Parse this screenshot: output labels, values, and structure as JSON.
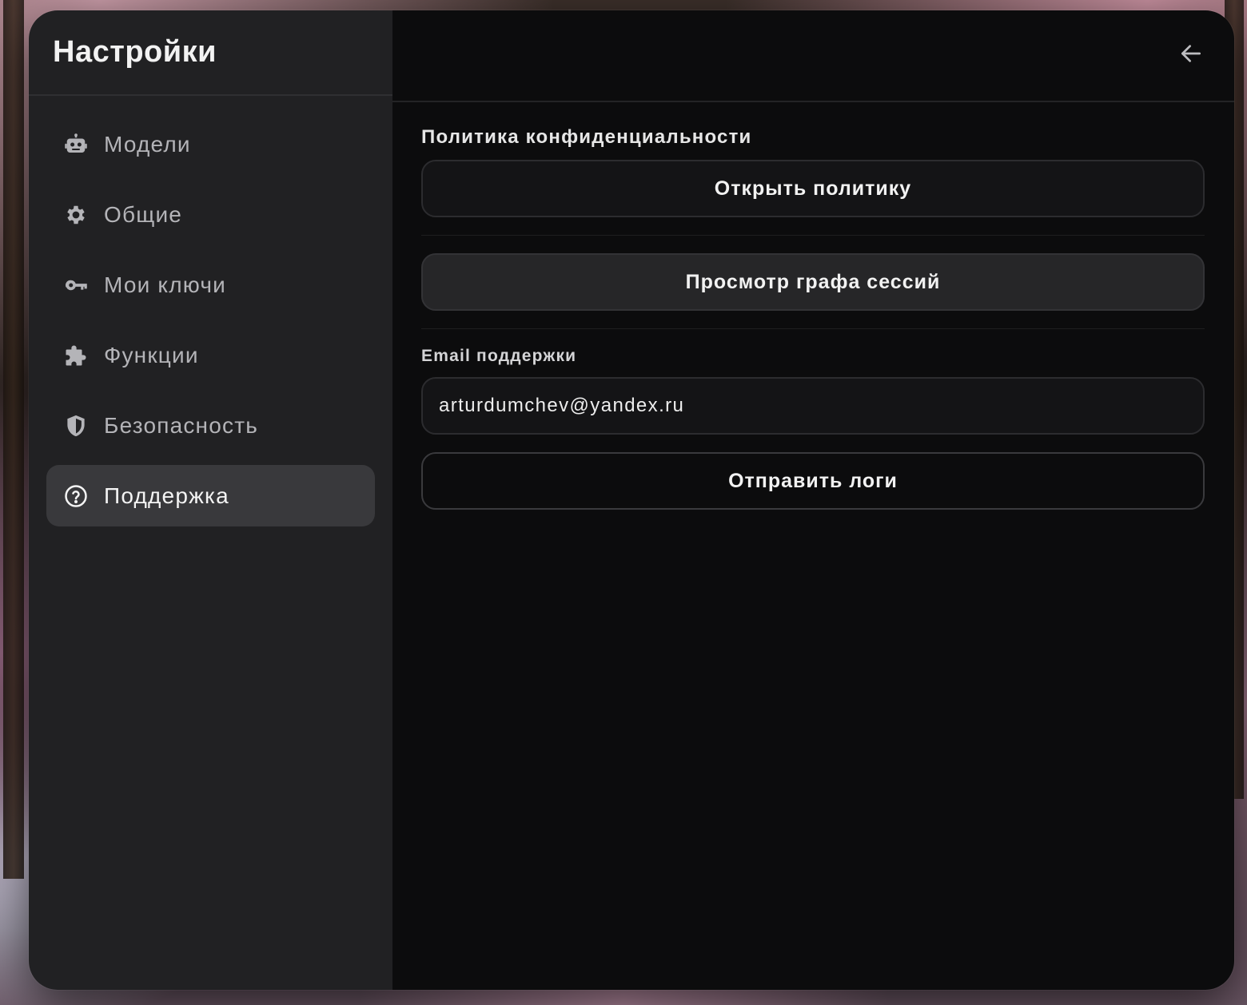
{
  "sidebar": {
    "title": "Настройки",
    "items": [
      {
        "label": "Модели",
        "icon": "robot-icon",
        "active": false
      },
      {
        "label": "Общие",
        "icon": "gear-icon",
        "active": false
      },
      {
        "label": "Мои ключи",
        "icon": "key-icon",
        "active": false
      },
      {
        "label": "Функции",
        "icon": "puzzle-icon",
        "active": false
      },
      {
        "label": "Безопасность",
        "icon": "shield-icon",
        "active": false
      },
      {
        "label": "Поддержка",
        "icon": "help-circle-icon",
        "active": true
      }
    ]
  },
  "header": {
    "back_icon": "arrow-left-icon"
  },
  "support": {
    "privacy_label": "Политика конфиденциальности",
    "open_policy_label": "Открыть политику",
    "session_graph_label": "Просмотр графа сессий",
    "email_label": "Email поддержки",
    "email_value": "arturdumchev@yandex.ru",
    "send_logs_label": "Отправить логи"
  },
  "colors": {
    "sidebar_bg": "#212123",
    "main_bg": "#0c0c0d",
    "active_item_bg": "#39393c",
    "text_primary": "#f2f2f2",
    "text_secondary": "#b4b4b8"
  }
}
